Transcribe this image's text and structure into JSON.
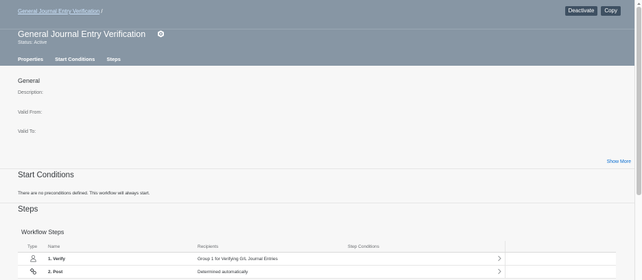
{
  "header": {
    "breadcrumb_link": "General Journal Entry Verification",
    "breadcrumb_sep": "/",
    "title": "General Journal Entry Verification",
    "status": "Status: Active",
    "actions": {
      "deactivate": "Deactivate",
      "copy": "Copy"
    },
    "tabs": [
      "Properties",
      "Start Conditions",
      "Steps"
    ]
  },
  "general": {
    "heading": "General",
    "description_label": "Description:",
    "valid_from_label": "Valid From:",
    "valid_to_label": "Valid To:",
    "show_more": "Show More"
  },
  "start_conditions": {
    "heading": "Start Conditions",
    "text": "There are no preconditions defined. This workflow will always start."
  },
  "steps": {
    "heading": "Steps",
    "table_title": "Workflow Steps",
    "columns": [
      "Type",
      "Name",
      "Recipients",
      "Step Conditions"
    ],
    "rows": [
      {
        "icon": "person-icon",
        "name": "1. Verify",
        "recipients": "Group 1 for Verifying G/L Journal Entries",
        "conditions": ""
      },
      {
        "icon": "gears-icon",
        "name": "2. Post",
        "recipients": "Determined automatically",
        "conditions": ""
      }
    ]
  },
  "colors": {
    "header_bg": "#8796a4",
    "button_bg": "#3e5062",
    "link": "#0a6ed1"
  }
}
